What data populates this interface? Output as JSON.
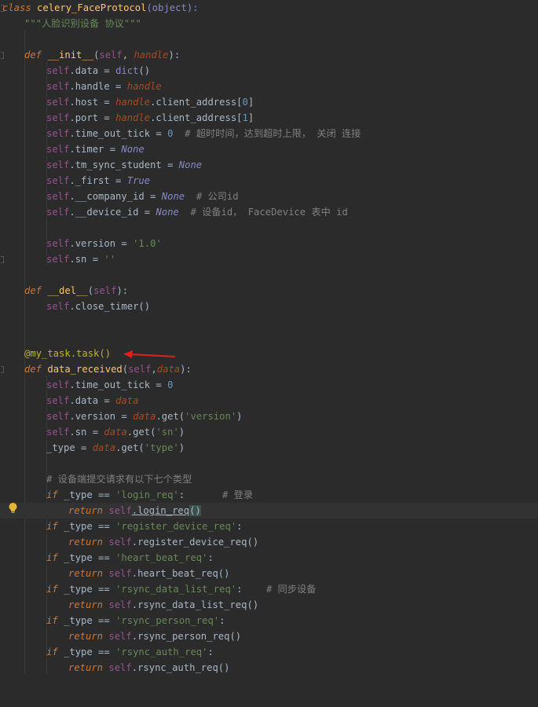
{
  "code": {
    "class_kw": "class",
    "class_name": "celery_FaceProtocol",
    "class_base": "(object):",
    "docstring": "\"\"\"人脸识别设备 协议\"\"\"",
    "def_kw": "def",
    "init_name": "__init__",
    "init_open": "(",
    "self": "self",
    "comma": ", ",
    "handle": "handle",
    "init_close": "):",
    "l_data_attr": ".data = ",
    "l_data_val": "dict",
    "l_data_paren": "()",
    "l_handle_attr": ".handle = ",
    "l_host_attr": ".host = ",
    "l_host_rest": ".client_address[",
    "zero": "0",
    "close_bracket": "]",
    "l_port_attr": ".port = ",
    "one": "1",
    "l_tick_attr": ".time_out_tick = ",
    "l_tick_comment": "# 超时时间，达到超时上限， 关闭 连接",
    "l_timer_attr": ".timer = ",
    "none": "None",
    "l_tmsync_attr": ".tm_sync_student = ",
    "l_first_attr": "._first = ",
    "true": "True",
    "l_company_attr": ".__company_id = ",
    "l_company_comment": "# 公司id",
    "l_device_attr": ".__device_id = ",
    "l_device_comment": "# 设备id， FaceDevice 表中 id",
    "l_version_attr": ".version = ",
    "version_val": "'1.0'",
    "l_sn_attr": ".sn = ",
    "empty_str": "''",
    "del_name": "__del__",
    "del_sig": "(",
    "del_close": "):",
    "close_timer_call": ".close_timer()",
    "decorator": "@my_task.task()",
    "data_received_name": "data_received",
    "data_param": "data",
    "self_comma": "(self,",
    "dr_close": "):",
    "data_assign": ".data = ",
    "data_get": ".get(",
    "version_key": "'version'",
    "sn_key": "'sn'",
    "type_var": "_type = ",
    "type_key": "'type'",
    "close_paren": ")",
    "types_comment": "# 设备端提交请求有以下七个类型",
    "if_kw": "if",
    "type_cmp": " _type == ",
    "colon": ":",
    "return_kw": "return",
    "login_key": "'login_req'",
    "login_comment": "# 登录",
    "login_call": ".login_req",
    "register_key": "'register_device_req'",
    "register_call": ".register_device_req()",
    "heart_key": "'heart_beat_req'",
    "heart_call": ".heart_beat_req()",
    "rsync_data_key": "'rsync_data_list_req'",
    "rsync_data_comment": "# 同步设备",
    "rsync_data_call": ".rsync_data_list_req()",
    "rsync_person_key": "'rsync_person_req'",
    "rsync_person_call": ".rsync_person_req()",
    "rsync_auth_key": "'rsync_auth_req'",
    "rsync_auth_call": ".rsync_auth_req()",
    "paren_open": "(",
    "paren_close": ")"
  },
  "colors": {
    "background": "#2b2b2b",
    "keyword": "#cc7832",
    "function": "#ffc66d",
    "string": "#6a8759",
    "number": "#6897bb",
    "comment": "#808080",
    "decorator": "#bbb529",
    "self": "#94558d",
    "annotation_arrow": "#e02020"
  },
  "icons": {
    "gutter": "lightbulb-icon",
    "annotation": "red-arrow-icon"
  }
}
